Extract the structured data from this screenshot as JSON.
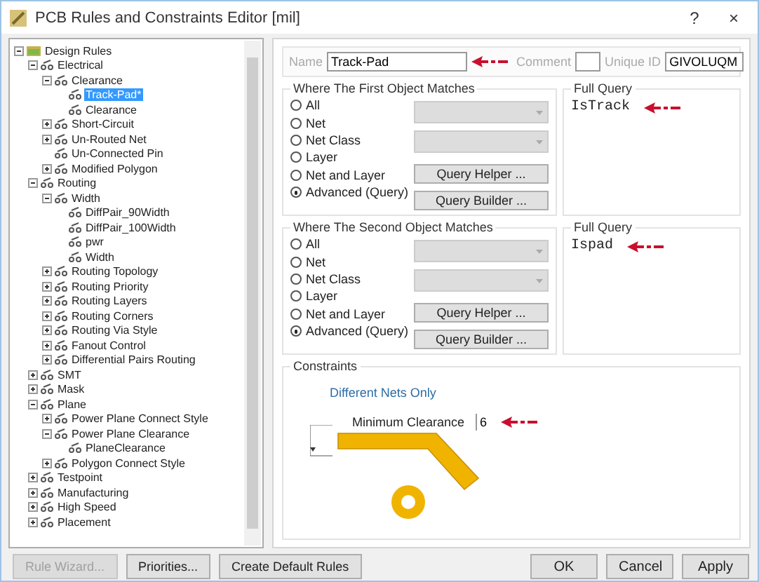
{
  "window": {
    "title": "PCB Rules and Constraints Editor [mil]",
    "help": "?",
    "close": "×"
  },
  "tree": [
    {
      "label": "Design Rules",
      "kind": "branch",
      "expanded": true,
      "selected": false,
      "children": [
        {
          "label": "Electrical",
          "kind": "branch",
          "expanded": true,
          "selected": false,
          "children": [
            {
              "label": "Clearance",
              "kind": "branch",
              "expanded": true,
              "selected": false,
              "children": [
                {
                  "label": "Track-Pad*",
                  "kind": "leaf",
                  "selected": true
                },
                {
                  "label": "Clearance",
                  "kind": "leaf",
                  "selected": false
                }
              ]
            },
            {
              "label": "Short-Circuit",
              "kind": "branch",
              "expanded": false,
              "selected": false
            },
            {
              "label": "Un-Routed Net",
              "kind": "branch",
              "expanded": false,
              "selected": false
            },
            {
              "label": "Un-Connected Pin",
              "kind": "leaf",
              "selected": false
            },
            {
              "label": "Modified Polygon",
              "kind": "branch",
              "expanded": false,
              "selected": false
            }
          ]
        },
        {
          "label": "Routing",
          "kind": "branch",
          "expanded": true,
          "selected": false,
          "children": [
            {
              "label": "Width",
              "kind": "branch",
              "expanded": true,
              "selected": false,
              "children": [
                {
                  "label": "DiffPair_90Width",
                  "kind": "leaf",
                  "selected": false
                },
                {
                  "label": "DiffPair_100Width",
                  "kind": "leaf",
                  "selected": false
                },
                {
                  "label": "pwr",
                  "kind": "leaf",
                  "selected": false
                },
                {
                  "label": "Width",
                  "kind": "leaf",
                  "selected": false
                }
              ]
            },
            {
              "label": "Routing Topology",
              "kind": "branch",
              "expanded": false,
              "selected": false
            },
            {
              "label": "Routing Priority",
              "kind": "branch",
              "expanded": false,
              "selected": false
            },
            {
              "label": "Routing Layers",
              "kind": "branch",
              "expanded": false,
              "selected": false
            },
            {
              "label": "Routing Corners",
              "kind": "branch",
              "expanded": false,
              "selected": false
            },
            {
              "label": "Routing Via Style",
              "kind": "branch",
              "expanded": false,
              "selected": false
            },
            {
              "label": "Fanout Control",
              "kind": "branch",
              "expanded": false,
              "selected": false
            },
            {
              "label": "Differential Pairs Routing",
              "kind": "branch",
              "expanded": false,
              "selected": false
            }
          ]
        },
        {
          "label": "SMT",
          "kind": "branch",
          "expanded": false,
          "selected": false
        },
        {
          "label": "Mask",
          "kind": "branch",
          "expanded": false,
          "selected": false
        },
        {
          "label": "Plane",
          "kind": "branch",
          "expanded": true,
          "selected": false,
          "children": [
            {
              "label": "Power Plane Connect Style",
              "kind": "branch",
              "expanded": false,
              "selected": false
            },
            {
              "label": "Power Plane Clearance",
              "kind": "branch",
              "expanded": true,
              "selected": false,
              "children": [
                {
                  "label": "PlaneClearance",
                  "kind": "leaf",
                  "selected": false
                }
              ]
            },
            {
              "label": "Polygon Connect Style",
              "kind": "branch",
              "expanded": false,
              "selected": false
            }
          ]
        },
        {
          "label": "Testpoint",
          "kind": "branch",
          "expanded": false,
          "selected": false
        },
        {
          "label": "Manufacturing",
          "kind": "branch",
          "expanded": false,
          "selected": false
        },
        {
          "label": "High Speed",
          "kind": "branch",
          "expanded": false,
          "selected": false
        },
        {
          "label": "Placement",
          "kind": "branch",
          "expanded": false,
          "selected": false
        }
      ]
    }
  ],
  "rule": {
    "name_label": "Name",
    "name": "Track-Pad",
    "comment_label": "Comment",
    "unique_id_label": "Unique ID",
    "unique_id": "GIVOLUQM"
  },
  "matches": [
    {
      "title": "Where The First Object Matches",
      "options": [
        {
          "label": "All",
          "selected": false
        },
        {
          "label": "Net",
          "selected": false
        },
        {
          "label": "Net Class",
          "selected": false
        },
        {
          "label": "Layer",
          "selected": false
        },
        {
          "label": "Net and Layer",
          "selected": false
        },
        {
          "label": "Advanced (Query)",
          "selected": true
        }
      ],
      "buttons": [
        "Query Helper ...",
        "Query Builder ..."
      ],
      "query_title": "Full Query",
      "query": "IsTrack"
    },
    {
      "title": "Where The Second Object Matches",
      "options": [
        {
          "label": "All",
          "selected": false
        },
        {
          "label": "Net",
          "selected": false
        },
        {
          "label": "Net Class",
          "selected": false
        },
        {
          "label": "Layer",
          "selected": false
        },
        {
          "label": "Net and Layer",
          "selected": false
        },
        {
          "label": "Advanced (Query)",
          "selected": true
        }
      ],
      "buttons": [
        "Query Helper ...",
        "Query Builder ..."
      ],
      "query_title": "Full Query",
      "query": "Ispad"
    }
  ],
  "constraints": {
    "title": "Constraints",
    "scope": "Different Nets Only",
    "label": "Minimum Clearance",
    "value": "6"
  },
  "left_buttons": [
    {
      "label": "Rule Wizard...",
      "disabled": true
    },
    {
      "label": "Priorities...",
      "disabled": false
    },
    {
      "label": "Create Default Rules",
      "disabled": false
    }
  ],
  "right_buttons": [
    {
      "label": "OK",
      "disabled": false
    },
    {
      "label": "Cancel",
      "disabled": false
    },
    {
      "label": "Apply",
      "disabled": false
    }
  ]
}
